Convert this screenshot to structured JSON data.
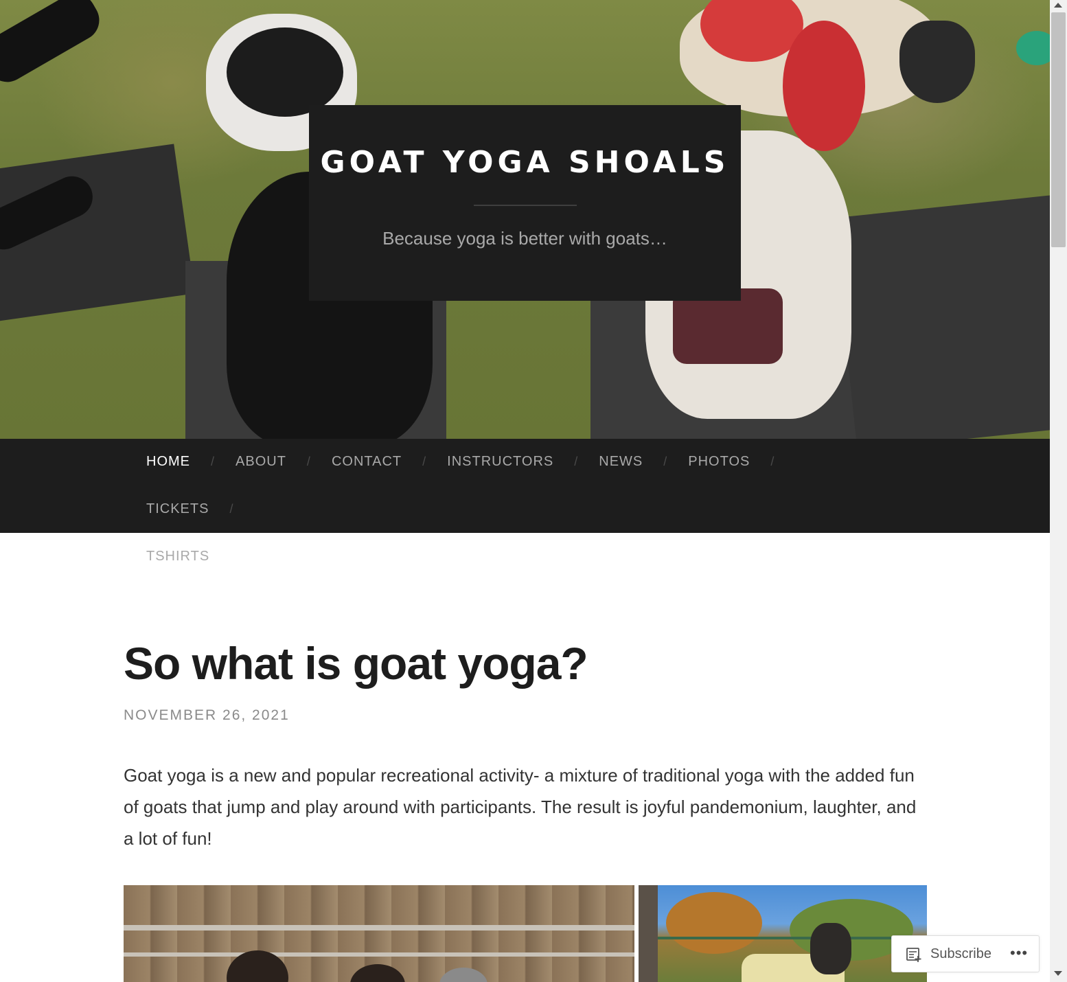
{
  "site": {
    "title": "GOAT YOGA SHOALS",
    "tagline": "Because yoga is better with goats…"
  },
  "nav": {
    "items": [
      {
        "label": "HOME",
        "active": true
      },
      {
        "label": "ABOUT"
      },
      {
        "label": "CONTACT"
      },
      {
        "label": "INSTRUCTORS"
      },
      {
        "label": "NEWS"
      },
      {
        "label": "PHOTOS"
      },
      {
        "label": "TICKETS"
      },
      {
        "label": "TSHIRTS"
      }
    ],
    "separator": "/"
  },
  "post": {
    "title": "So what is goat yoga?",
    "date": "NOVEMBER 26, 2021",
    "body": "Goat yoga is a new and popular recreational activity- a mixture of traditional yoga with the added fun of goats that jump and play around with participants. The result is joyful pandemonium, laughter, and a lot of fun!"
  },
  "subscribe": {
    "label": "Subscribe",
    "icon": "subscribe-icon",
    "more": "•••"
  },
  "colors": {
    "header_bg": "#1d1d1d",
    "nav_text": "#a9a9a9",
    "nav_active": "#ffffff",
    "title_text": "#1d1d1d",
    "date_text": "#8a8a8a"
  }
}
